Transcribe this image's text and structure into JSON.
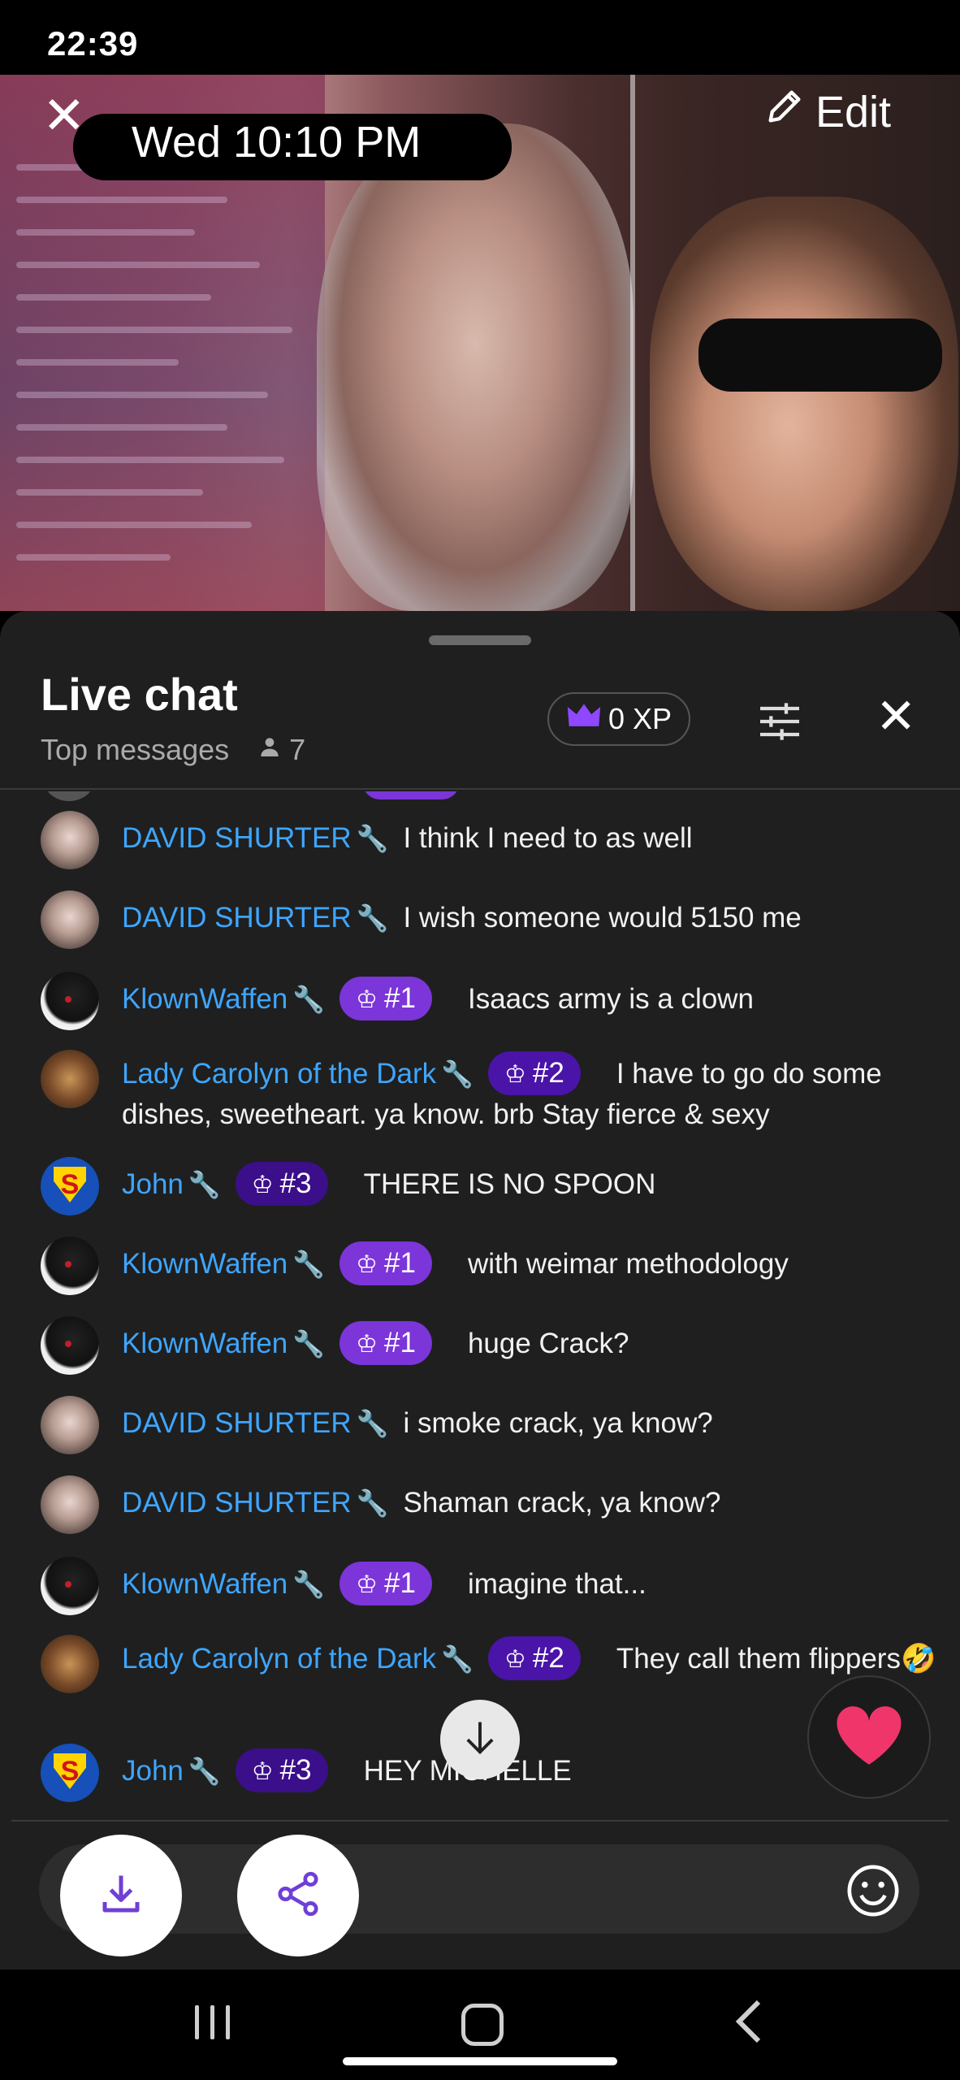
{
  "status_bar": {
    "time": "22:39"
  },
  "video": {
    "date_time": "Wed 10:10 PM",
    "edit_label": "Edit"
  },
  "chat": {
    "title": "Live chat",
    "mode": "Top messages",
    "viewer_count": "7",
    "xp": "0 XP",
    "accent_color": "#3ea6ff",
    "messages": [
      {
        "author": "DAVID SHURTER",
        "avatar": "david",
        "rank": "",
        "text": "I think I need to as well"
      },
      {
        "author": "DAVID SHURTER",
        "avatar": "david",
        "rank": "",
        "text": "I wish someone would 5150 me"
      },
      {
        "author": "KlownWaffen",
        "avatar": "klown",
        "rank": "#1",
        "text": "Isaacs army is a clown"
      },
      {
        "author": "Lady Carolyn of the Dark",
        "avatar": "lady",
        "rank": "#2",
        "text": "I have to go do some dishes, sweetheart. ya know. brb Stay fierce & sexy"
      },
      {
        "author": "John",
        "avatar": "john",
        "rank": "#3",
        "text": "THERE IS NO SPOON"
      },
      {
        "author": "KlownWaffen",
        "avatar": "klown",
        "rank": "#1",
        "text": "with weimar methodology"
      },
      {
        "author": "KlownWaffen",
        "avatar": "klown",
        "rank": "#1",
        "text": "huge Crack?"
      },
      {
        "author": "DAVID SHURTER",
        "avatar": "david",
        "rank": "",
        "text": "i smoke crack, ya know?"
      },
      {
        "author": "DAVID SHURTER",
        "avatar": "david",
        "rank": "",
        "text": "Shaman crack, ya know?"
      },
      {
        "author": "KlownWaffen",
        "avatar": "klown",
        "rank": "#1",
        "text": "imagine that..."
      },
      {
        "author": "Lady Carolyn of the Dark",
        "avatar": "lady",
        "rank": "#2",
        "text": "They call them flippers🤣"
      },
      {
        "author": "John",
        "avatar": "john",
        "rank": "#3",
        "text": "HEY MICHELLE"
      }
    ]
  },
  "icons": {
    "close": "close-icon",
    "edit": "pencil-icon",
    "person": "person-icon",
    "crown": "crown-icon",
    "filter": "sliders-icon",
    "wrench": "wrench-icon",
    "scroll_down": "arrow-down-icon",
    "heart": "heart-icon",
    "emoji": "smiley-icon",
    "download": "download-icon",
    "share": "share-icon"
  }
}
